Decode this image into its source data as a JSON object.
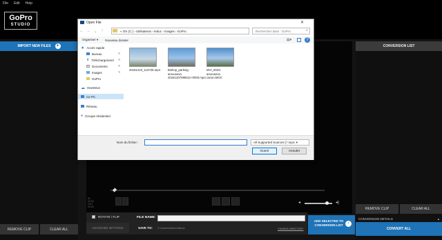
{
  "menu": [
    "File",
    "Edit",
    "Help"
  ],
  "logo": {
    "line1": "GoPro",
    "line2": "STUDIO"
  },
  "left_panel": {
    "import_label": "IMPORT NEW FILES",
    "remove_clip": "REMOVE CLIP",
    "clear_all": "CLEAR ALL"
  },
  "right_panel": {
    "title": "CONVERSION LIST",
    "remove_clip": "REMOVE CLIP",
    "clear_all": "CLEAR ALL",
    "details": "CONVERSION DETAILS",
    "convert_all": "CONVERT ALL"
  },
  "player": {
    "time_lines": [
      "IN",
      "00:00",
      "OUT",
      "00:00"
    ]
  },
  "bottom": {
    "rotate_label": "ROTATE / FLIP",
    "file_name_label": "FILE NAME:",
    "save_to_label": "SAVE TO:",
    "save_to_path": "C:\\Users\\leduc\\Videos",
    "change_directory": "CHANGE DIRECTORY",
    "advanced_settings": "ADVANCED SETTINGS",
    "add_selected": "ADD SELECTED TO CONVERSION LIST"
  },
  "dialog": {
    "title": "Open File",
    "breadcrumb": "« OS (C:) › Utilisateurs › leduc › Images › GoPro",
    "search_placeholder": "Rechercher dans : GoPro",
    "organize": "Organiser ▾",
    "new_folder": "Nouveau dossier",
    "nav": {
      "quick_access": "Accès rapide",
      "desktop": "Bureau",
      "downloads": "Téléchargement",
      "documents": "Documents",
      "images": "Images",
      "gopro": "GoPro",
      "onedrive": "OneDrive",
      "this_pc": "Ce PC",
      "network": "Réseau",
      "homegroup": "Groupe résidentiel"
    },
    "files": [
      {
        "name": "20161210_113726.mp4"
      },
      {
        "name": "Bishop_parking-amouseva 20161207095011+0000.mp4"
      },
      {
        "name": "MVI_0033-amouseva canon.MOV"
      }
    ],
    "file_name_label": "Nom du fichier :",
    "file_name_value": "",
    "filter": "All Supported Sources (*.mp4, ▾",
    "open": "Ouvrir",
    "cancel": "Annuler"
  }
}
